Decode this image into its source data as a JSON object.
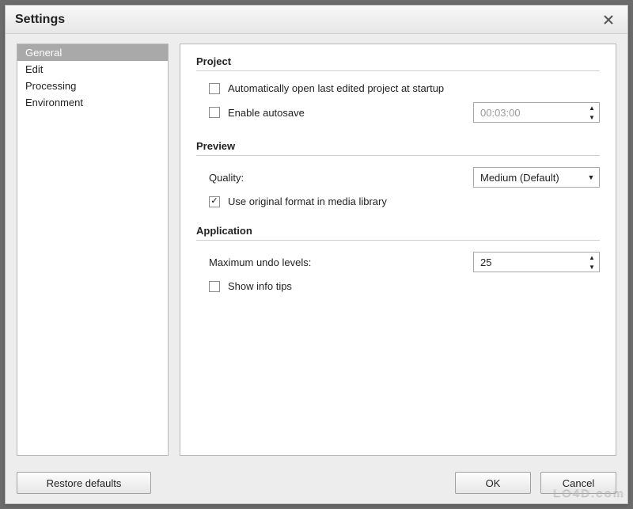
{
  "window": {
    "title": "Settings"
  },
  "sidebar": {
    "items": [
      {
        "label": "General",
        "selected": true
      },
      {
        "label": "Edit",
        "selected": false
      },
      {
        "label": "Processing",
        "selected": false
      },
      {
        "label": "Environment",
        "selected": false
      }
    ]
  },
  "sections": {
    "project": {
      "heading": "Project",
      "open_last_label": "Automatically open last edited project at startup",
      "open_last_checked": false,
      "autosave_label": "Enable autosave",
      "autosave_checked": false,
      "autosave_value": "00:03:00"
    },
    "preview": {
      "heading": "Preview",
      "quality_label": "Quality:",
      "quality_value": "Medium (Default)",
      "use_original_label": "Use original format in media library",
      "use_original_checked": true
    },
    "application": {
      "heading": "Application",
      "undo_label": "Maximum undo levels:",
      "undo_value": "25",
      "show_tips_label": "Show info tips",
      "show_tips_checked": false
    }
  },
  "footer": {
    "restore": "Restore defaults",
    "ok": "OK",
    "cancel": "Cancel"
  },
  "watermark": "LO4D.com"
}
